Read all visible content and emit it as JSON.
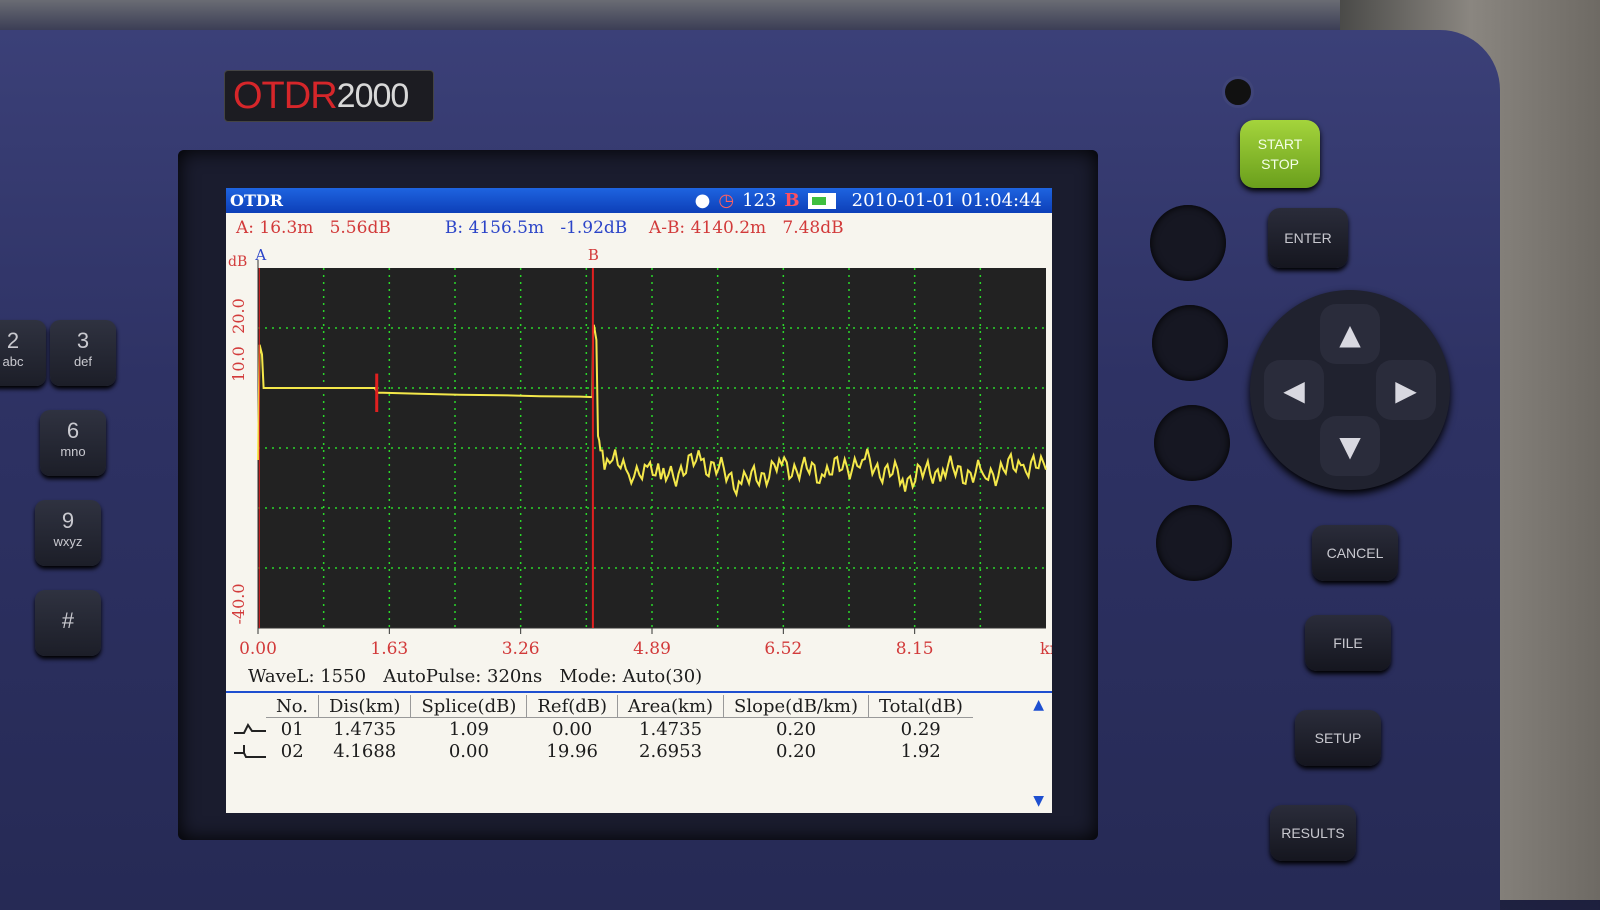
{
  "device": {
    "brand_red": "OTDR",
    "brand_white": "2000",
    "start_label_1": "START",
    "start_label_2": "STOP",
    "enter_label": "ENTER",
    "cancel_label": "CANCEL",
    "file_label": "FILE",
    "setup_label": "SETUP",
    "results_label": "RESULTS",
    "keys": [
      {
        "num": "2",
        "sub": "abc"
      },
      {
        "num": "3",
        "sub": "def"
      },
      {
        "num": "6",
        "sub": "mno"
      },
      {
        "num": "9",
        "sub": "wxyz"
      },
      {
        "num": "#",
        "sub": ""
      }
    ],
    "accent_green": "#8cc22c",
    "body_color": "#2e3264"
  },
  "screen": {
    "title": "OTDR",
    "status_count": "123",
    "status_marker": "B",
    "datetime": "2010-01-01  01:04:44",
    "cursor_a": "A: 16.3m   5.56dB",
    "cursor_b": "B: 4156.5m   -1.92dB",
    "cursor_ab": "A-B: 4140.2m   7.48dB",
    "marker_a": "A",
    "marker_b": "B",
    "params": "WaveL: 1550   AutoPulse: 320ns   Mode: Auto(30)",
    "table": {
      "headers": [
        "No.",
        "Dis(km)",
        "Splice(dB)",
        "Ref(dB)",
        "Area(km)",
        "Slope(dB/km)",
        "Total(dB)"
      ],
      "rows": [
        [
          "01",
          "1.4735",
          "1.09",
          "0.00",
          "1.4735",
          "0.20",
          "0.29"
        ],
        [
          "02",
          "4.1688",
          "0.00",
          "19.96",
          "2.6953",
          "0.20",
          "1.92"
        ]
      ]
    },
    "icons": [
      "pin-icon",
      "clock-icon",
      "battery-icon",
      "event-nonreflective-icon",
      "event-reflective-icon",
      "scroll-up-icon",
      "scroll-down-icon"
    ]
  },
  "chart_data": {
    "type": "line",
    "title": "",
    "xlabel": "km",
    "ylabel": "dB",
    "x_ticks": [
      "0.00",
      "1.63",
      "3.26",
      "4.89",
      "6.52",
      "8.15"
    ],
    "y_ticks": [
      "20.0",
      "10.0",
      "-40.0"
    ],
    "xlim": [
      0,
      9.78
    ],
    "ylim": [
      -45,
      30
    ],
    "grid": true,
    "colors": {
      "trace": "#f4e84a",
      "grid": "#2ad62a",
      "cursor": "#e02020",
      "background": "#222222"
    },
    "series": [
      {
        "x": [
          0.0,
          0.02,
          0.05,
          0.07,
          0.5,
          1.0,
          1.45,
          1.48,
          1.55,
          2.0,
          2.5,
          3.0,
          3.5,
          4.0,
          4.15,
          4.16,
          4.17,
          4.2,
          4.22,
          4.25,
          4.3,
          4.4,
          4.6,
          4.8,
          5.0,
          5.5,
          6.0,
          6.5,
          7.0,
          7.5,
          8.0,
          8.5,
          9.0,
          9.5,
          9.78
        ],
        "y": [
          -10,
          14,
          12,
          5,
          5,
          5,
          5,
          4,
          4,
          3.8,
          3.6,
          3.5,
          3.3,
          3.2,
          3.1,
          18,
          18,
          15,
          -5,
          -8,
          -12,
          -10,
          -13,
          -11,
          -14,
          -10,
          -15,
          -11,
          -13,
          -10,
          -14,
          -12,
          -13,
          -11,
          -12
        ]
      }
    ],
    "cursor_a_km": 0.0163,
    "cursor_b_km": 4.1565,
    "event_marker_km": 1.4735
  }
}
